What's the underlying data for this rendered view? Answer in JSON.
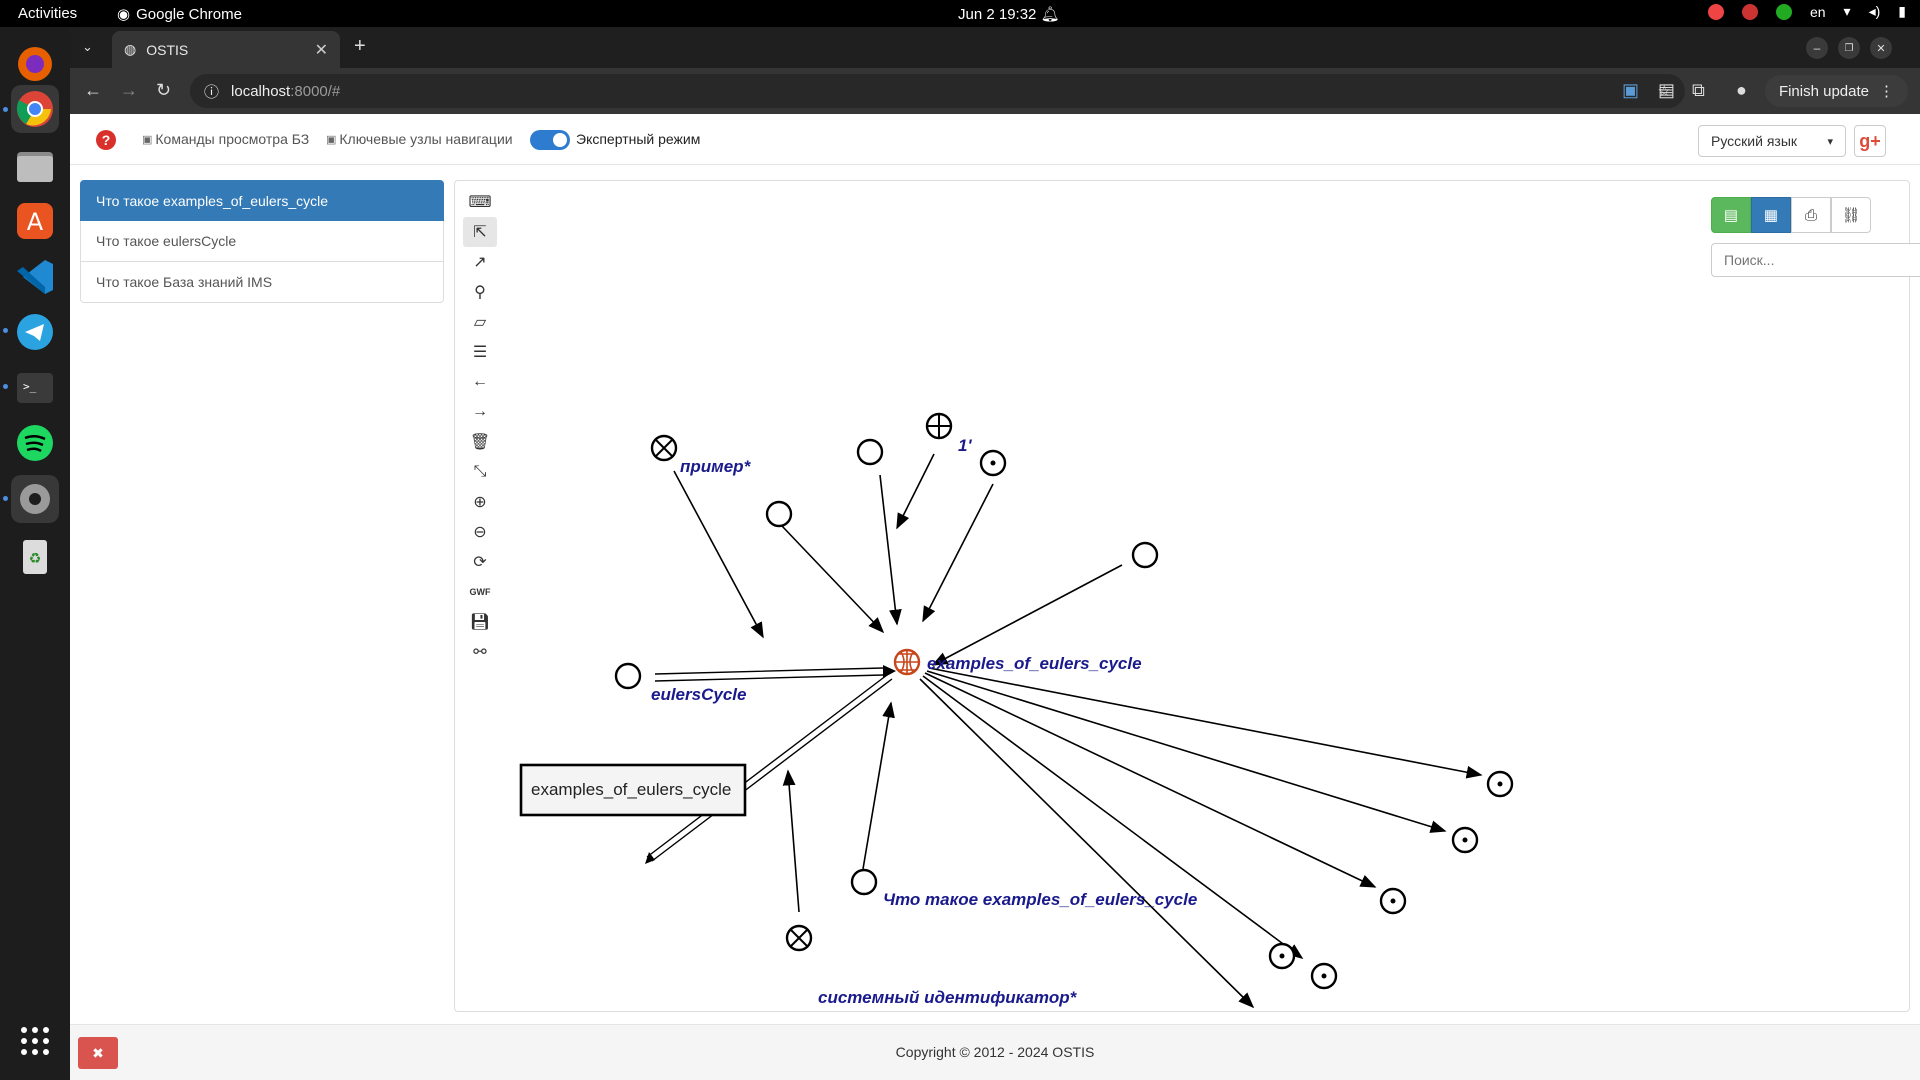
{
  "os": {
    "activities": "Activities",
    "app_name": "Google Chrome",
    "clock": "Jun 2  19:32",
    "lang": "en"
  },
  "browser": {
    "tab_title": "OSTIS",
    "url_host": "localhost",
    "url_rest": ":8000/#",
    "finish_update": "Finish update"
  },
  "header": {
    "help": "?",
    "link_commands": "Команды просмотра БЗ",
    "link_nav": "Ключевые узлы навигации",
    "expert_mode": "Экспертный режим",
    "expert_on": true,
    "language": "Русский язык",
    "gplus": "g+"
  },
  "history": [
    "Что такое examples_of_eulers_cycle",
    "Что такое eulersCycle",
    "Что такое База знаний IMS"
  ],
  "search": {
    "placeholder": "Поиск..."
  },
  "graph": {
    "labels": {
      "primer": "пример*",
      "one": "1'",
      "center": "examples_of_eulers_cycle",
      "eulers": "eulersCycle",
      "box": "examples_of_eulers_cycle",
      "question": "Что такое examples_of_eulers_cycle",
      "sysid": "системный идентификатор*"
    }
  },
  "footer": {
    "copyright": "Copyright © 2012 - 2024 OSTIS"
  }
}
